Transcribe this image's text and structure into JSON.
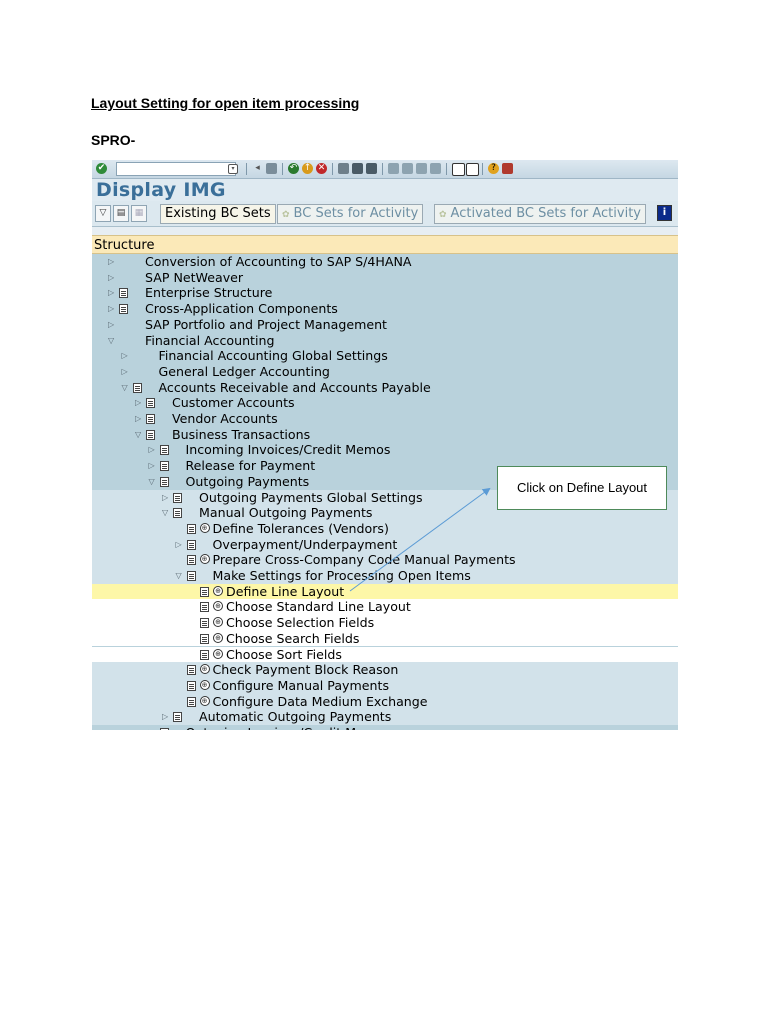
{
  "document": {
    "heading": "Layout Setting for open item processing",
    "spro": "SPRO-"
  },
  "sap": {
    "title": "Display IMG",
    "toolbar_buttons": {
      "existing_bc_sets": "Existing BC Sets",
      "bc_sets_for_activity": "BC Sets for Activity",
      "activated_bc_sets": "Activated BC Sets for Activity"
    },
    "structure_header": "Structure",
    "tree": [
      {
        "label": "Conversion of Accounting to SAP S/4HANA",
        "level": 0,
        "state": "collapsed",
        "doc": false,
        "clock": false
      },
      {
        "label": "SAP NetWeaver",
        "level": 0,
        "state": "collapsed",
        "doc": false,
        "clock": false
      },
      {
        "label": "Enterprise Structure",
        "level": 0,
        "state": "collapsed",
        "doc": true,
        "clock": false
      },
      {
        "label": "Cross-Application Components",
        "level": 0,
        "state": "collapsed",
        "doc": true,
        "clock": false
      },
      {
        "label": "SAP Portfolio and Project Management",
        "level": 0,
        "state": "collapsed",
        "doc": false,
        "clock": false
      },
      {
        "label": "Financial Accounting",
        "level": 0,
        "state": "expanded",
        "doc": false,
        "clock": false
      },
      {
        "label": "Financial Accounting Global Settings",
        "level": 1,
        "state": "collapsed",
        "doc": false,
        "clock": false
      },
      {
        "label": "General Ledger Accounting",
        "level": 1,
        "state": "collapsed",
        "doc": false,
        "clock": false
      },
      {
        "label": "Accounts Receivable and Accounts Payable",
        "level": 1,
        "state": "expanded",
        "doc": true,
        "clock": false
      },
      {
        "label": "Customer Accounts",
        "level": 2,
        "state": "collapsed",
        "doc": true,
        "clock": false
      },
      {
        "label": "Vendor Accounts",
        "level": 2,
        "state": "collapsed",
        "doc": true,
        "clock": false
      },
      {
        "label": "Business Transactions",
        "level": 2,
        "state": "expanded",
        "doc": true,
        "clock": false
      },
      {
        "label": "Incoming Invoices/Credit Memos",
        "level": 3,
        "state": "collapsed",
        "doc": true,
        "clock": false
      },
      {
        "label": "Release for Payment",
        "level": 3,
        "state": "collapsed",
        "doc": true,
        "clock": false
      },
      {
        "label": "Outgoing Payments",
        "level": 3,
        "state": "expanded",
        "doc": true,
        "clock": false
      },
      {
        "label": "Outgoing Payments Global Settings",
        "level": 4,
        "state": "collapsed",
        "doc": true,
        "clock": false,
        "shade": "light"
      },
      {
        "label": "Manual Outgoing Payments",
        "level": 4,
        "state": "expanded",
        "doc": true,
        "clock": false,
        "shade": "light"
      },
      {
        "label": "Define Tolerances (Vendors)",
        "level": 5,
        "state": "leaf",
        "doc": true,
        "clock": true,
        "shade": "light"
      },
      {
        "label": "Overpayment/Underpayment",
        "level": 5,
        "state": "collapsed",
        "doc": true,
        "clock": false,
        "shade": "light"
      },
      {
        "label": "Prepare Cross-Company Code Manual Payments",
        "level": 5,
        "state": "leaf",
        "doc": true,
        "clock": true,
        "shade": "light"
      },
      {
        "label": "Make Settings for Processing Open Items",
        "level": 5,
        "state": "expanded",
        "doc": true,
        "clock": false,
        "shade": "light"
      },
      {
        "label": "Define Line Layout",
        "level": 6,
        "state": "leaf",
        "doc": true,
        "clock": true,
        "shade": "hl"
      },
      {
        "label": "Choose Standard Line Layout",
        "level": 6,
        "state": "leaf",
        "doc": true,
        "clock": true,
        "shade": "white"
      },
      {
        "label": "Choose Selection Fields",
        "level": 6,
        "state": "leaf",
        "doc": true,
        "clock": true,
        "shade": "white"
      },
      {
        "label": "Choose Search Fields",
        "level": 6,
        "state": "leaf",
        "doc": true,
        "clock": true,
        "shade": "white"
      },
      {
        "label": "Choose Sort Fields",
        "level": 6,
        "state": "leaf",
        "doc": true,
        "clock": true,
        "shade": "white"
      },
      {
        "label": "Check Payment Block Reason",
        "level": 5,
        "state": "leaf",
        "doc": true,
        "clock": true,
        "shade": "light"
      },
      {
        "label": "Configure Manual Payments",
        "level": 5,
        "state": "leaf",
        "doc": true,
        "clock": true,
        "shade": "light"
      },
      {
        "label": "Configure Data Medium Exchange",
        "level": 5,
        "state": "leaf",
        "doc": true,
        "clock": true,
        "shade": "light"
      },
      {
        "label": "Automatic Outgoing Payments",
        "level": 4,
        "state": "collapsed",
        "doc": true,
        "clock": false,
        "shade": "light"
      },
      {
        "label": "Outgoing Invoices/Credit Memos",
        "level": 3,
        "state": "collapsed",
        "doc": true,
        "clock": false
      }
    ]
  },
  "callout": {
    "text": "Click on Define Layout"
  },
  "colors": {
    "tree_bg": "#b9d2dc",
    "tree_light": "#d2e2ea",
    "highlight": "#fdf7a8",
    "title": "#3a6f99"
  }
}
